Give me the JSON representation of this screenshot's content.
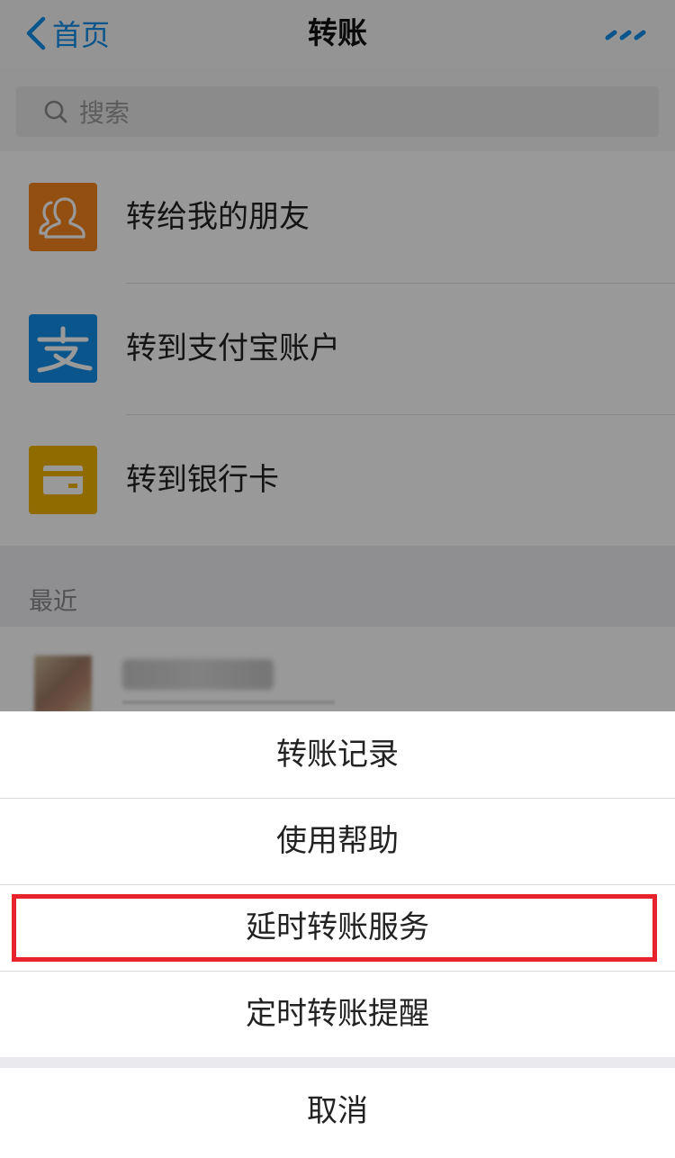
{
  "navbar": {
    "back_label": "首页",
    "title": "转账",
    "more_icon": "ellipsis-icon",
    "accent_color": "#108ee9"
  },
  "search": {
    "placeholder": "搜索",
    "icon": "search-icon"
  },
  "functions": [
    {
      "label": "转给我的朋友",
      "icon": "friends-icon",
      "icon_color": "#f5821f"
    },
    {
      "label": "转到支付宝账户",
      "icon": "alipay-icon",
      "icon_color": "#108ee9"
    },
    {
      "label": "转到银行卡",
      "icon": "bank-card-icon",
      "icon_color": "#f0b500"
    }
  ],
  "recent": {
    "section_label": "最近"
  },
  "action_sheet": {
    "items": [
      "转账记录",
      "使用帮助",
      "延时转账服务",
      "定时转账提醒"
    ],
    "highlighted_item": "延时转账服务",
    "highlight_color": "#e8232b",
    "cancel_label": "取消"
  }
}
